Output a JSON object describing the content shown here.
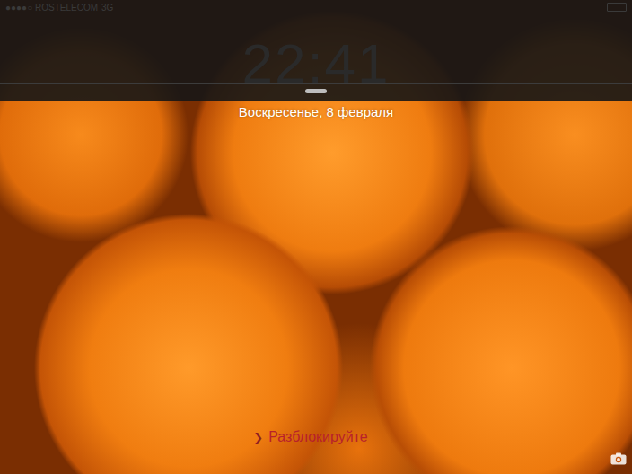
{
  "status_bar": {
    "carrier": "●●●●○ ROSTELECOM",
    "network": "3G"
  },
  "clock": "22:41",
  "date": "Воскресенье, 8 февраля",
  "unlock": {
    "chevron": "❯",
    "label": "Разблокируйте"
  }
}
